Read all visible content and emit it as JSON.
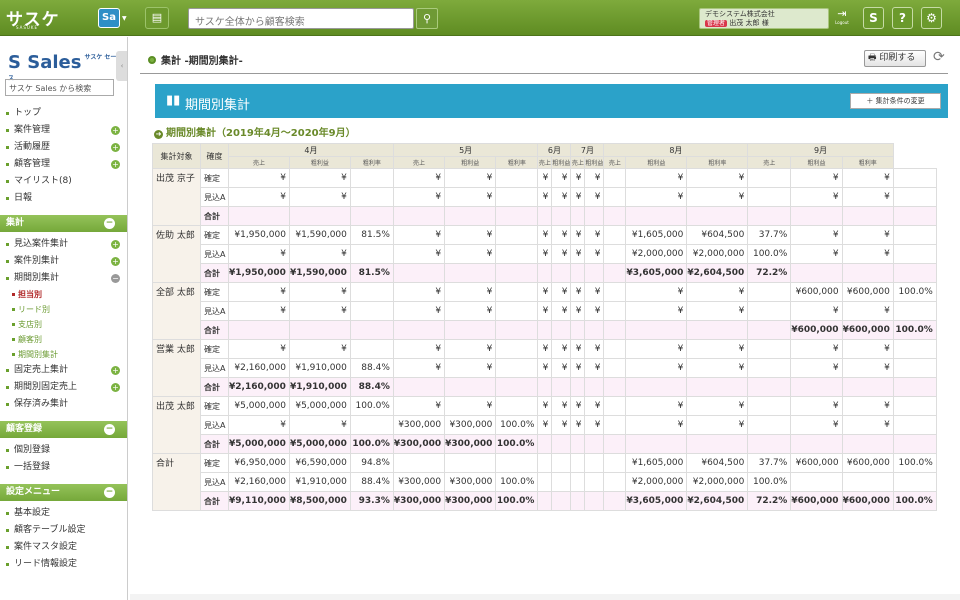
{
  "header": {
    "logo_text": "サスケ",
    "logo_sub": "SASUKE",
    "app_badge": "Sa",
    "search_placeholder": "サスケ全体から顧客検索",
    "company": "デモシステム株式会社",
    "role": "管理者",
    "user": "出茂 太郎 様",
    "logout_label": "Logout"
  },
  "sidebar": {
    "logo": "Sales",
    "logo_sub": "サスケ セールス",
    "search_placeholder": "サスケ Sales から検索",
    "top_items": [
      {
        "label": "トップ"
      },
      {
        "label": "案件管理",
        "plus": "+"
      },
      {
        "label": "活動履歴",
        "plus": "+"
      },
      {
        "label": "顧客管理",
        "plus": "+"
      },
      {
        "label": "マイリスト(8)"
      },
      {
        "label": "日報"
      }
    ],
    "section_summary": "集計",
    "summary_items": [
      {
        "label": "見込案件集計",
        "plus": "+"
      },
      {
        "label": "案件別集計",
        "plus": "+"
      },
      {
        "label": "期間別集計",
        "plus": "−"
      }
    ],
    "summary_sub": [
      {
        "label": "担当別",
        "active": true
      },
      {
        "label": "リード別"
      },
      {
        "label": "支店別"
      },
      {
        "label": "顧客別"
      },
      {
        "label": "期間別集計"
      }
    ],
    "summary_items2": [
      {
        "label": "固定売上集計",
        "plus": "+"
      },
      {
        "label": "期間別固定売上",
        "plus": "+"
      },
      {
        "label": "保存済み集計"
      }
    ],
    "section_customer": "顧客登録",
    "customer_items": [
      {
        "label": "個別登録"
      },
      {
        "label": "一括登録"
      }
    ],
    "section_settings": "設定メニュー",
    "settings_items": [
      {
        "label": "基本設定"
      },
      {
        "label": "顧客テーブル設定"
      },
      {
        "label": "案件マスタ設定"
      },
      {
        "label": "リード情報設定"
      }
    ]
  },
  "page": {
    "title": "集計 -期間別集計-",
    "print": "印刷する",
    "banner": "期間別集計",
    "cond_btn": "＋ 集計条件の変更",
    "section": "期間別集計（2019年4月～2020年9月）"
  },
  "table": {
    "h_target": "集計対象",
    "h_type": "確度",
    "months": [
      "4月",
      "5月",
      "6月",
      "7月",
      "8月",
      "9月"
    ],
    "cols": [
      "売上",
      "粗利益",
      "粗利率"
    ],
    "rows": [
      [
        "出茂 京子",
        "確定",
        "¥",
        "¥",
        "",
        "¥",
        "¥",
        "",
        "¥",
        "¥",
        "¥",
        "¥",
        "",
        "¥",
        "¥",
        "",
        "¥",
        "¥",
        ""
      ],
      [
        "",
        "見込A",
        "¥",
        "¥",
        "",
        "¥",
        "¥",
        "",
        "¥",
        "¥",
        "¥",
        "¥",
        "",
        "¥",
        "¥",
        "",
        "¥",
        "¥",
        ""
      ],
      [
        "",
        "合計",
        "",
        "",
        "",
        "",
        "",
        "",
        "",
        "",
        "",
        "",
        "",
        "",
        "",
        "",
        "",
        "",
        ""
      ],
      [
        "佐助 太郎",
        "確定",
        "¥1,950,000",
        "¥1,590,000",
        "81.5%",
        "¥",
        "¥",
        "",
        "¥",
        "¥",
        "¥",
        "¥",
        "",
        "¥1,605,000",
        "¥604,500",
        "37.7%",
        "¥",
        "¥",
        ""
      ],
      [
        "",
        "見込A",
        "¥",
        "¥",
        "",
        "¥",
        "¥",
        "",
        "¥",
        "¥",
        "¥",
        "¥",
        "",
        "¥2,000,000",
        "¥2,000,000",
        "100.0%",
        "¥",
        "¥",
        ""
      ],
      [
        "",
        "合計",
        "¥1,950,000",
        "¥1,590,000",
        "81.5%",
        "",
        "",
        "",
        "",
        "",
        "",
        "",
        "",
        "¥3,605,000",
        "¥2,604,500",
        "72.2%",
        "",
        "",
        ""
      ],
      [
        "全部 太郎",
        "確定",
        "¥",
        "¥",
        "",
        "¥",
        "¥",
        "",
        "¥",
        "¥",
        "¥",
        "¥",
        "",
        "¥",
        "¥",
        "",
        "¥600,000",
        "¥600,000",
        "100.0%"
      ],
      [
        "",
        "見込A",
        "¥",
        "¥",
        "",
        "¥",
        "¥",
        "",
        "¥",
        "¥",
        "¥",
        "¥",
        "",
        "¥",
        "¥",
        "",
        "¥",
        "¥",
        ""
      ],
      [
        "",
        "合計",
        "",
        "",
        "",
        "",
        "",
        "",
        "",
        "",
        "",
        "",
        "",
        "",
        "",
        "",
        "¥600,000",
        "¥600,000",
        "100.0%"
      ],
      [
        "営業 太郎",
        "確定",
        "¥",
        "¥",
        "",
        "¥",
        "¥",
        "",
        "¥",
        "¥",
        "¥",
        "¥",
        "",
        "¥",
        "¥",
        "",
        "¥",
        "¥",
        ""
      ],
      [
        "",
        "見込A",
        "¥2,160,000",
        "¥1,910,000",
        "88.4%",
        "¥",
        "¥",
        "",
        "¥",
        "¥",
        "¥",
        "¥",
        "",
        "¥",
        "¥",
        "",
        "¥",
        "¥",
        ""
      ],
      [
        "",
        "合計",
        "¥2,160,000",
        "¥1,910,000",
        "88.4%",
        "",
        "",
        "",
        "",
        "",
        "",
        "",
        "",
        "",
        "",
        "",
        "",
        "",
        ""
      ],
      [
        "出茂 太郎",
        "確定",
        "¥5,000,000",
        "¥5,000,000",
        "100.0%",
        "¥",
        "¥",
        "",
        "¥",
        "¥",
        "¥",
        "¥",
        "",
        "¥",
        "¥",
        "",
        "¥",
        "¥",
        ""
      ],
      [
        "",
        "見込A",
        "¥",
        "¥",
        "",
        "¥300,000",
        "¥300,000",
        "100.0%",
        "¥",
        "¥",
        "¥",
        "¥",
        "",
        "¥",
        "¥",
        "",
        "¥",
        "¥",
        ""
      ],
      [
        "",
        "合計",
        "¥5,000,000",
        "¥5,000,000",
        "100.0%",
        "¥300,000",
        "¥300,000",
        "100.0%",
        "",
        "",
        "",
        "",
        "",
        "",
        "",
        "",
        "",
        "",
        ""
      ],
      [
        "合計",
        "確定",
        "¥6,950,000",
        "¥6,590,000",
        "94.8%",
        "",
        "",
        "",
        "",
        "",
        "",
        "",
        "",
        "¥1,605,000",
        "¥604,500",
        "37.7%",
        "¥600,000",
        "¥600,000",
        "100.0%"
      ],
      [
        "",
        "見込A",
        "¥2,160,000",
        "¥1,910,000",
        "88.4%",
        "¥300,000",
        "¥300,000",
        "100.0%",
        "",
        "",
        "",
        "",
        "",
        "¥2,000,000",
        "¥2,000,000",
        "100.0%",
        "",
        "",
        ""
      ],
      [
        "",
        "合計",
        "¥9,110,000",
        "¥8,500,000",
        "93.3%",
        "¥300,000",
        "¥300,000",
        "100.0%",
        "",
        "",
        "",
        "",
        "",
        "¥3,605,000",
        "¥2,604,500",
        "72.2%",
        "¥600,000",
        "¥600,000",
        "100.0%"
      ]
    ]
  }
}
